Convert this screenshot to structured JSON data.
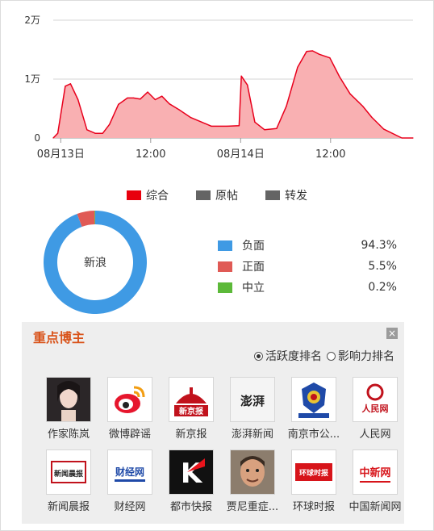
{
  "chart_data": [
    {
      "type": "area",
      "y_ticks": [
        "0",
        "1万",
        "2万"
      ],
      "ylim": [
        0,
        20000
      ],
      "x_ticks": [
        "08月13日",
        "12:00",
        "08月14日",
        "12:00"
      ],
      "x_tick_hours": [
        0,
        12,
        24,
        36
      ],
      "xlim": [
        -1,
        47
      ],
      "grid": true,
      "series": [
        {
          "name": "综合",
          "color": "#e8001c",
          "fill": "#f9b0b2",
          "x": [
            -1,
            -0.4,
            0.6,
            1.3,
            2.3,
            3.5,
            4.6,
            5.6,
            6.5,
            7.7,
            8.9,
            9.7,
            10.6,
            11.6,
            12.6,
            13.5,
            14.5,
            15.8,
            17.3,
            18.8,
            20.1,
            22.2,
            23.8,
            24.1,
            24.9,
            25.9,
            27.2,
            28.8,
            30.1,
            31.6,
            32.8,
            33.6,
            34.5,
            35.9,
            37.2,
            38.6,
            40.3,
            41.5,
            43.1,
            45.5,
            47
          ],
          "values": [
            0,
            800,
            8800,
            9200,
            6500,
            1400,
            800,
            800,
            2300,
            5700,
            6800,
            6800,
            6600,
            7800,
            6500,
            7100,
            5800,
            4800,
            3500,
            2700,
            2000,
            2000,
            2100,
            10500,
            9000,
            2700,
            1400,
            1600,
            5400,
            12000,
            14700,
            14800,
            14200,
            13600,
            10400,
            7500,
            5400,
            3500,
            1500,
            0,
            0
          ]
        }
      ],
      "legend": [
        {
          "label": "综合",
          "color": "#e8000d"
        },
        {
          "label": "原帖",
          "color": "#646464"
        },
        {
          "label": "转发",
          "color": "#646464"
        }
      ]
    },
    {
      "type": "pie",
      "center_label": "新浪",
      "slices": [
        {
          "label": "负面",
          "value": 94.3,
          "display": "94.3%",
          "color": "#3f9ae4"
        },
        {
          "label": "正面",
          "value": 5.5,
          "display": "5.5%",
          "color": "#e05a55"
        },
        {
          "label": "中立",
          "value": 0.2,
          "display": "0.2%",
          "color": "#5cb939"
        }
      ]
    }
  ],
  "panel": {
    "title": "重点博主",
    "close_icon": "×",
    "rank_options": [
      {
        "label": "活跃度排名",
        "selected": true
      },
      {
        "label": "影响力排名",
        "selected": false
      }
    ],
    "bloggers": [
      {
        "name": "作家陈岚",
        "icon": "portrait-woman"
      },
      {
        "name": "微博辟谣",
        "icon": "weibo-logo"
      },
      {
        "name": "新京报",
        "icon": "xinjingbao-logo",
        "logo_text": "新京报"
      },
      {
        "name": "澎湃新闻",
        "icon": "pengpai-logo",
        "logo_text": "澎湃"
      },
      {
        "name": "南京市公...",
        "icon": "police-emblem"
      },
      {
        "name": "人民网",
        "icon": "people-logo",
        "logo_text": "人民网"
      },
      {
        "name": "新闻晨报",
        "icon": "chenbao-logo",
        "logo_text": "新闻晨报"
      },
      {
        "name": "财经网",
        "icon": "caijing-logo",
        "logo_text": "财经网"
      },
      {
        "name": "都市快报",
        "icon": "dushikuaibao-logo",
        "logo_text": "K"
      },
      {
        "name": "贾尼重症...",
        "icon": "portrait-man"
      },
      {
        "name": "环球时报",
        "icon": "huanqiu-logo",
        "logo_text": "环球时报"
      },
      {
        "name": "中国新闻网",
        "icon": "chinanews-logo",
        "logo_text": "中新网"
      }
    ]
  }
}
